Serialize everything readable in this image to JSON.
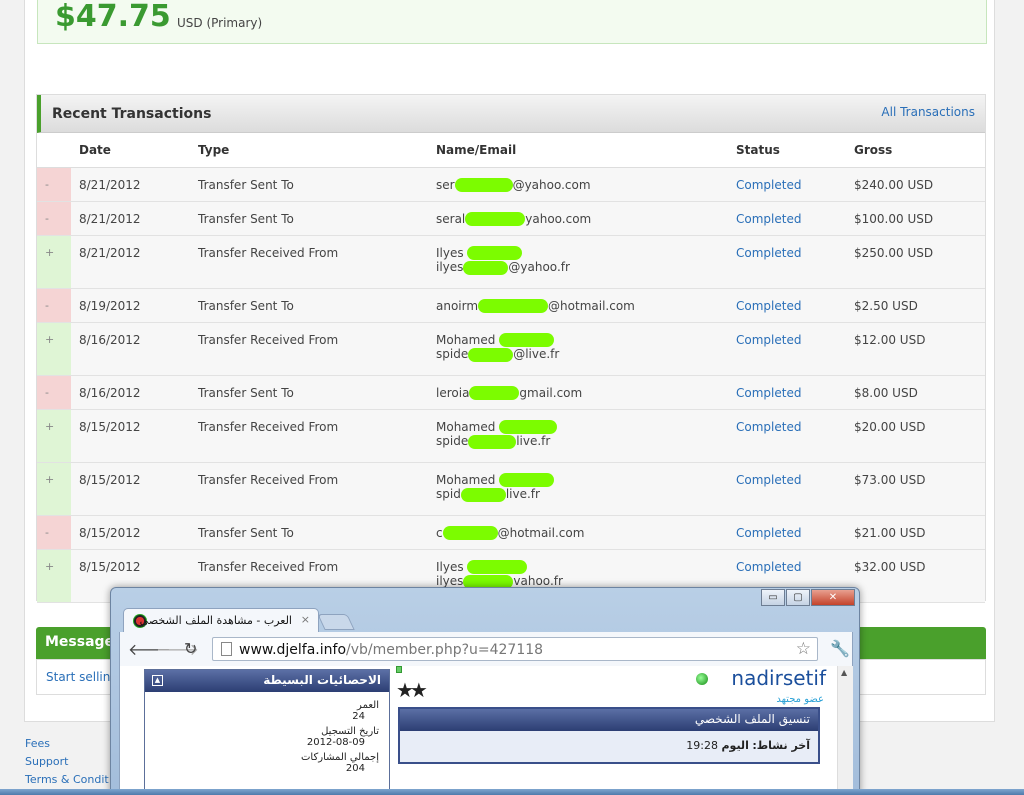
{
  "balance": {
    "amount": "$47.75",
    "currency_label": "USD (Primary)"
  },
  "transactions": {
    "title": "Recent Transactions",
    "all_link": "All Transactions",
    "columns": [
      "Date",
      "Type",
      "Name/Email",
      "Status",
      "Gross"
    ],
    "rows": [
      {
        "sign": "-",
        "date": "8/21/2012",
        "type": "Transfer Sent To",
        "name": "ser",
        "email_start": "",
        "email_end": "@yahoo.com",
        "status": "Completed",
        "gross": "$240.00 USD"
      },
      {
        "sign": "-",
        "date": "8/21/2012",
        "type": "Transfer Sent To",
        "name": "seral",
        "email_start": "",
        "email_end": "yahoo.com",
        "status": "Completed",
        "gross": "$100.00 USD"
      },
      {
        "sign": "+",
        "date": "8/21/2012",
        "type": "Transfer Received From",
        "name": "Ilyes",
        "email_start": "ilyes",
        "email_end": "@yahoo.fr",
        "status": "Completed",
        "gross": "$250.00 USD"
      },
      {
        "sign": "-",
        "date": "8/19/2012",
        "type": "Transfer Sent To",
        "name": "anoirm",
        "email_start": "",
        "email_end": "@hotmail.com",
        "status": "Completed",
        "gross": "$2.50 USD"
      },
      {
        "sign": "+",
        "date": "8/16/2012",
        "type": "Transfer Received From",
        "name": "Mohamed",
        "email_start": "spide",
        "email_end": "@live.fr",
        "status": "Completed",
        "gross": "$12.00 USD"
      },
      {
        "sign": "-",
        "date": "8/16/2012",
        "type": "Transfer Sent To",
        "name": "leroia",
        "email_start": "",
        "email_end": "gmail.com",
        "status": "Completed",
        "gross": "$8.00 USD"
      },
      {
        "sign": "+",
        "date": "8/15/2012",
        "type": "Transfer Received From",
        "name": "Mohamed",
        "email_start": "spide",
        "email_end": "live.fr",
        "status": "Completed",
        "gross": "$20.00 USD"
      },
      {
        "sign": "+",
        "date": "8/15/2012",
        "type": "Transfer Received From",
        "name": "Mohamed",
        "email_start": "spid",
        "email_end": "live.fr",
        "status": "Completed",
        "gross": "$73.00 USD"
      },
      {
        "sign": "-",
        "date": "8/15/2012",
        "type": "Transfer Sent To",
        "name": "c",
        "email_start": "",
        "email_end": "@hotmail.com",
        "status": "Completed",
        "gross": "$21.00 USD"
      },
      {
        "sign": "+",
        "date": "8/15/2012",
        "type": "Transfer Received From",
        "name": "Ilyes",
        "email_start": "ilyes",
        "email_end": "vahoo.fr",
        "status": "Completed",
        "gross": "$32.00 USD"
      }
    ]
  },
  "message": {
    "title": "Message",
    "link": "Start sellin"
  },
  "footer": {
    "links": [
      "Fees",
      "Support",
      "Terms & Condit"
    ]
  },
  "browser": {
    "tab_title": "العرب - مشاهدة الملف الشخصي",
    "tab_close": "×",
    "url_host": "www.djelfa.info",
    "url_path": "/vb/member.php?u=427118",
    "window_minimize": "▭",
    "window_maximize": "▢",
    "window_close": "✕",
    "stats": {
      "title": "الاحصائيات البسيطة",
      "age_label": "العمر",
      "age_value": "24",
      "join_label": "تاريخ التسجيل",
      "join_value": "2012-08-09",
      "posts_label": "إجمالي المشاركات",
      "posts_value": "204"
    },
    "profile": {
      "username": "nadirsetif",
      "rank": "عضو مجتهد",
      "box_title": "تنسيق الملف الشخصي",
      "last_activity_label": "آخر نشاط:",
      "last_activity_day": "اليوم",
      "last_activity_time": "19:28"
    }
  }
}
